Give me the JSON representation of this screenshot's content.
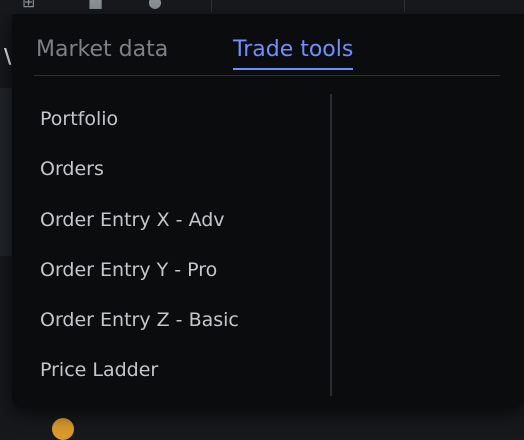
{
  "tabs": [
    {
      "label": "Market data",
      "active": false
    },
    {
      "label": "Trade tools",
      "active": true
    }
  ],
  "menu": {
    "items": [
      {
        "label": "Portfolio"
      },
      {
        "label": "Orders"
      },
      {
        "label": "Order Entry X - Adv"
      },
      {
        "label": "Order Entry Y - Pro"
      },
      {
        "label": "Order Entry Z - Basic"
      },
      {
        "label": "Price Ladder"
      }
    ]
  },
  "colors": {
    "accent": "#6f8fff",
    "popup_bg": "#0b0c0e",
    "text": "#c5c7cc",
    "muted": "#7d8088"
  },
  "icons": [
    "add-icon",
    "square-icon",
    "circle-icon"
  ]
}
